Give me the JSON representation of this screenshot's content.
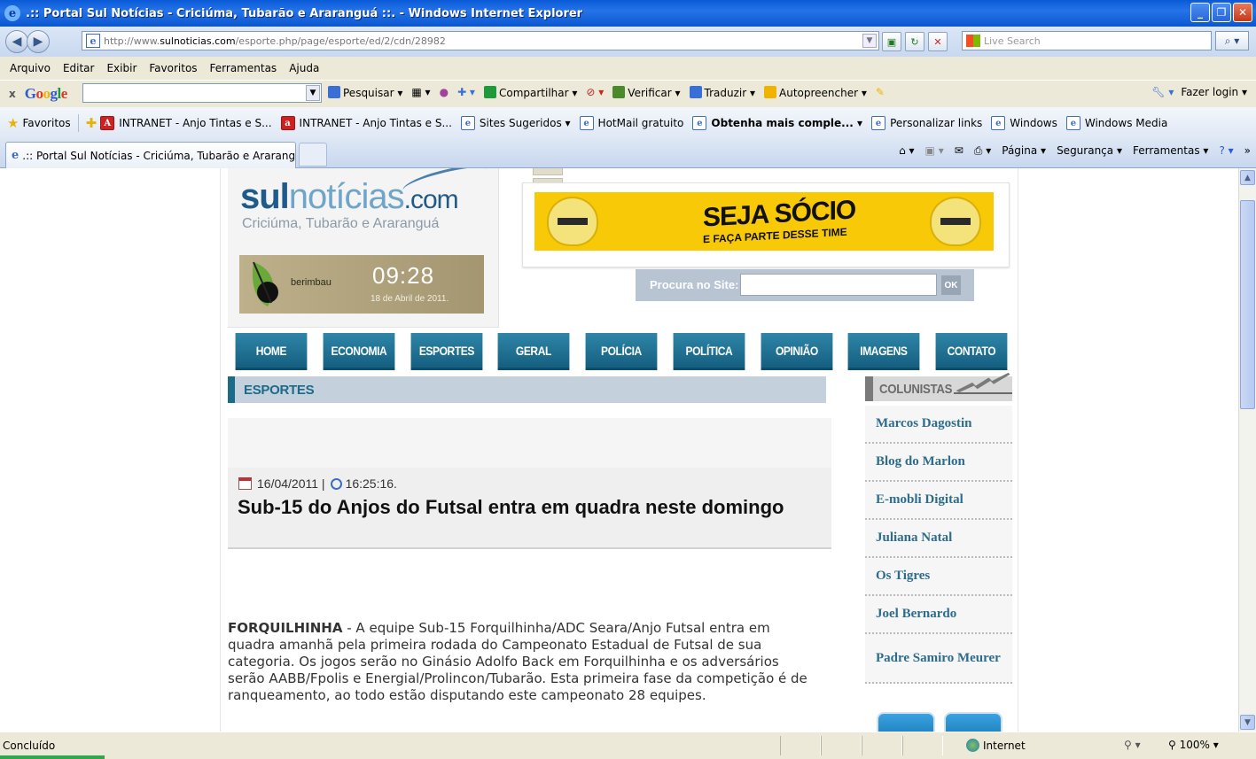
{
  "window": {
    "title": ".:: Portal Sul Notícias - Criciúma, Tubarão e Araranguá ::. - Windows Internet Explorer"
  },
  "address_bar": {
    "url_prefix": "http://www.",
    "url_domain": "sulnoticias.com",
    "url_path": "/esporte.php/page/esporte/ed/2/cdn/28982",
    "search_placeholder": "Live Search"
  },
  "menu": [
    "Arquivo",
    "Editar",
    "Exibir",
    "Favoritos",
    "Ferramentas",
    "Ajuda"
  ],
  "google_toolbar": {
    "close": "x",
    "logo": "Google",
    "items": [
      "Pesquisar ▾",
      "Compartilhar ▾",
      "Verificar ▾",
      "Traduzir ▾",
      "Autopreencher ▾"
    ],
    "login": "Fazer login ▾"
  },
  "favorites_bar": {
    "label": "Favoritos",
    "links": [
      "INTRANET - Anjo Tintas e S...",
      "INTRANET - Anjo Tintas e S...",
      "Sites Sugeridos ▾",
      "HotMail gratuito",
      "Obtenha mais comple... ▾",
      "Personalizar links",
      "Windows",
      "Windows Media"
    ]
  },
  "tab": {
    "label": ".:: Portal Sul Notícias - Criciúma, Tubarão e Ararangu..."
  },
  "command_bar": [
    "Página ▾",
    "Segurança ▾",
    "Ferramentas ▾"
  ],
  "site": {
    "logo_part1": "sul",
    "logo_part2": "notícias",
    "logo_part3": ".com",
    "tagline": "Criciúma, Tubarão e Araranguá",
    "clock": {
      "brand": "berimbau",
      "time": "09:28",
      "date": "18 de Abril de 2011."
    },
    "banner": {
      "main": "SEJA SÓCIO",
      "sub": "E FAÇA PARTE DESSE TIME"
    },
    "search": {
      "label": "Procura no Site:",
      "button": "OK"
    },
    "nav": [
      "HOME",
      "ECONOMIA",
      "ESPORTES",
      "GERAL",
      "POLÍCIA",
      "POLÍTICA",
      "OPINIÃO",
      "IMAGENS",
      "CONTATO"
    ],
    "section_title": "ESPORTES",
    "article": {
      "date": "16/04/2011 |",
      "time": "16:25:16.",
      "headline": "Sub-15 do Anjos do Futsal entra em quadra neste domingo",
      "lead_city": "FORQUILHINHA",
      "body": " - A equipe Sub-15 Forquilhinha/ADC Seara/Anjo Futsal entra em quadra amanhã pela primeira rodada do Campeonato Estadual de Futsal de sua categoria. Os jogos serão no Ginásio Adolfo Back em Forquilhinha e os adversários serão AABB/Fpolis e Energial/Prolincon/Tubarão. Esta primeira fase da competição é de ranqueamento, ao todo estão disputando este campeonato 28 equipes."
    },
    "columnists_title": "COLUNISTAS",
    "columnists": [
      "Marcos Dagostin",
      "Blog do Marlon",
      "E-mobli Digital",
      "Juliana Natal",
      "Os Tigres",
      "Joel Bernardo",
      "Padre Samiro Meurer"
    ]
  },
  "status_bar": {
    "text": "Concluído",
    "zone": "Internet",
    "zoom": "100%"
  }
}
